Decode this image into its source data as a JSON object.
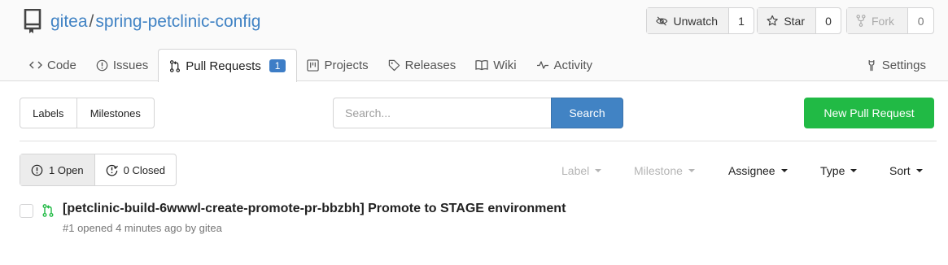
{
  "repo": {
    "owner": "gitea",
    "separator": "/",
    "name": "spring-petclinic-config"
  },
  "actions": {
    "watch": {
      "label": "Unwatch",
      "count": "1"
    },
    "star": {
      "label": "Star",
      "count": "0"
    },
    "fork": {
      "label": "Fork",
      "count": "0"
    }
  },
  "tabs": [
    {
      "label": "Code",
      "icon": "code-icon"
    },
    {
      "label": "Issues",
      "icon": "issue-icon"
    },
    {
      "label": "Pull Requests",
      "icon": "pull-request-icon",
      "badge": "1",
      "active": true
    },
    {
      "label": "Projects",
      "icon": "project-icon"
    },
    {
      "label": "Releases",
      "icon": "tag-icon"
    },
    {
      "label": "Wiki",
      "icon": "book-icon"
    },
    {
      "label": "Activity",
      "icon": "pulse-icon"
    }
  ],
  "settings_tab": {
    "label": "Settings",
    "icon": "tools-icon"
  },
  "toolbar": {
    "labels": "Labels",
    "milestones": "Milestones",
    "search_placeholder": "Search...",
    "search_button": "Search",
    "new_pr_button": "New Pull Request"
  },
  "state": {
    "open": "1 Open",
    "closed": "0 Closed"
  },
  "filters": {
    "label": "Label",
    "milestone": "Milestone",
    "assignee": "Assignee",
    "type": "Type",
    "sort": "Sort"
  },
  "pull_requests": [
    {
      "title": "[petclinic-build-6wwwl-create-promote-pr-bbzbh] Promote to STAGE environment",
      "meta": "#1 opened 4 minutes ago by gitea"
    }
  ],
  "colors": {
    "link": "#4183c4",
    "primary": "#4183c4",
    "green": "#21ba45",
    "badge": "#3d7dc6"
  }
}
